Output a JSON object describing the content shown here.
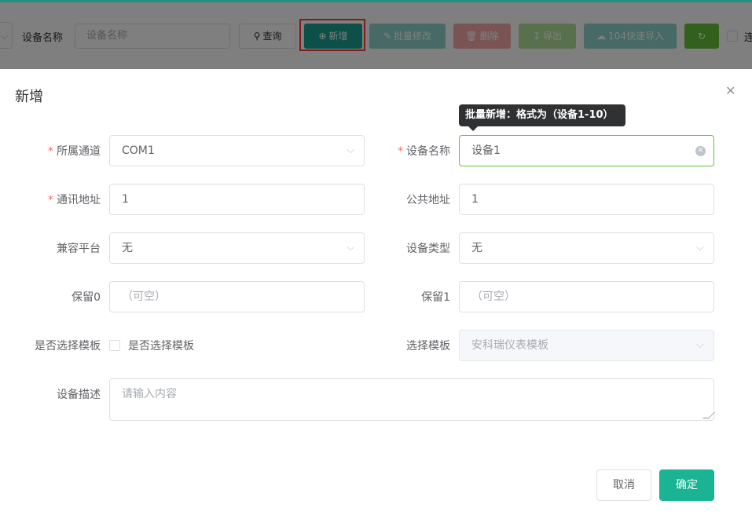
{
  "toolbar": {
    "device_name_label": "设备名称",
    "device_name_placeholder": "设备名称",
    "query_label": "查询",
    "add_label": "新增",
    "batch_edit_label": "批量修改",
    "delete_label": "删除",
    "export_label": "导出",
    "fast_import_label": "104快速导入",
    "cut_label": "连"
  },
  "dialog": {
    "title": "新增",
    "tooltip": "批量新增：格式为（设备1-10）",
    "fields": {
      "channel": {
        "label": "所属通道",
        "value": "COM1",
        "required": true
      },
      "device_name": {
        "label": "设备名称",
        "value": "设备1",
        "required": true
      },
      "comm_address": {
        "label": "通讯地址",
        "value": "1",
        "required": true
      },
      "public_address": {
        "label": "公共地址",
        "value": "1"
      },
      "platform": {
        "label": "兼容平台",
        "value": "无"
      },
      "device_type": {
        "label": "设备类型",
        "value": "无"
      },
      "reserve0": {
        "label": "保留0",
        "placeholder": "（可空）"
      },
      "reserve1": {
        "label": "保留1",
        "placeholder": "（可空）"
      },
      "use_template": {
        "label": "是否选择模板",
        "checkbox_label": "是否选择模板"
      },
      "template": {
        "label": "选择模板",
        "value": "安科瑞仪表模板"
      },
      "description": {
        "label": "设备描述",
        "placeholder": "请输入内容"
      }
    },
    "cancel_label": "取消",
    "confirm_label": "确定"
  },
  "colors": {
    "primary": "#1aa093",
    "confirm": "#1ab394",
    "focus_border": "#67c23a",
    "highlight_frame": "#ff3b3b",
    "required_star": "#f56c6c"
  }
}
